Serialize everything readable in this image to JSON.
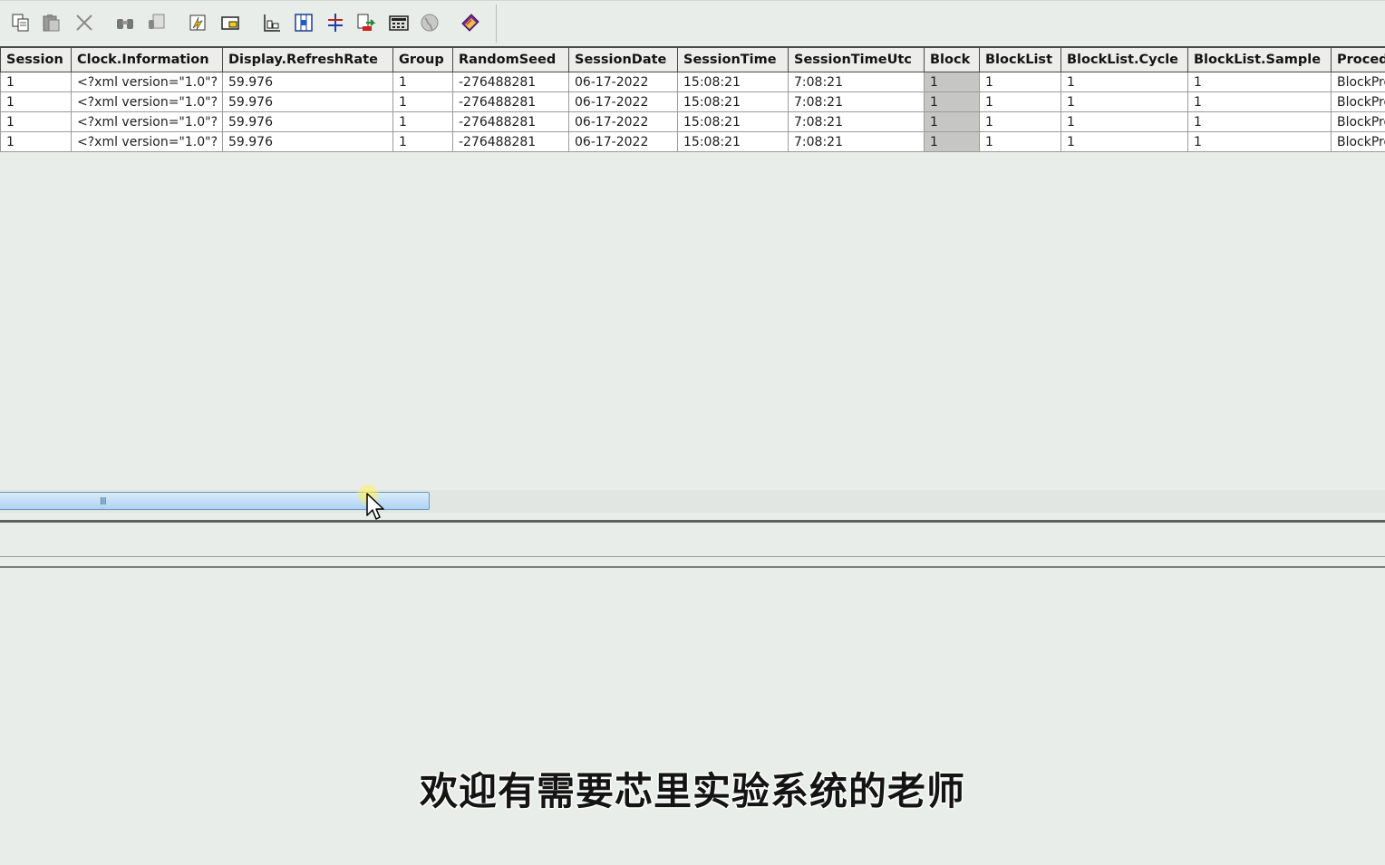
{
  "toolbar": {
    "buttons": [
      {
        "name": "copy-icon"
      },
      {
        "name": "paste-icon"
      },
      {
        "name": "cut-icon"
      },
      {
        "name": "find-icon"
      },
      {
        "name": "replace-icon"
      },
      {
        "name": "filter-icon"
      },
      {
        "name": "hide-column-icon"
      },
      {
        "name": "arrange-columns-icon"
      },
      {
        "name": "select-columns-icon"
      },
      {
        "name": "sort-icon"
      },
      {
        "name": "export-icon"
      },
      {
        "name": "calculator-icon"
      },
      {
        "name": "globe-icon"
      },
      {
        "name": "book-icon"
      }
    ]
  },
  "table": {
    "columns": [
      "Session",
      "Clock.Information",
      "Display.RefreshRate",
      "Group",
      "RandomSeed",
      "SessionDate",
      "SessionTime",
      "SessionTimeUtc",
      "Block",
      "BlockList",
      "BlockList.Cycle",
      "BlockList.Sample",
      "Procedure"
    ],
    "rows": [
      [
        "1",
        "<?xml version=\"1.0\"?",
        "59.976",
        "1",
        "-276488281",
        "06-17-2022",
        "15:08:21",
        "7:08:21",
        "1",
        "1",
        "1",
        "1",
        "BlockProc"
      ],
      [
        "1",
        "<?xml version=\"1.0\"?",
        "59.976",
        "1",
        "-276488281",
        "06-17-2022",
        "15:08:21",
        "7:08:21",
        "1",
        "1",
        "1",
        "1",
        "BlockProc"
      ],
      [
        "1",
        "<?xml version=\"1.0\"?",
        "59.976",
        "1",
        "-276488281",
        "06-17-2022",
        "15:08:21",
        "7:08:21",
        "1",
        "1",
        "1",
        "1",
        "BlockProc"
      ],
      [
        "1",
        "<?xml version=\"1.0\"?",
        "59.976",
        "1",
        "-276488281",
        "06-17-2022",
        "15:08:21",
        "7:08:21",
        "1",
        "1",
        "1",
        "1",
        "BlockProc"
      ]
    ],
    "selected_column": "Block"
  },
  "scrollbar": {
    "grip": "III"
  },
  "subtitle": "欢迎有需要芯里实验系统的老师"
}
